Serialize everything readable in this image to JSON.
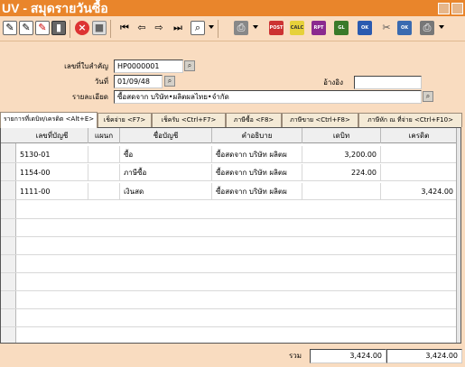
{
  "window": {
    "title": "UV - สมุดรายวันซื้อ"
  },
  "toolbar": {
    "icons": [
      "new-doc-icon",
      "edit-doc-icon",
      "copy-doc-icon",
      "trash-icon",
      "cancel-icon",
      "save-icon",
      "first-record-icon",
      "prev-record-icon",
      "next-record-icon",
      "last-record-icon",
      "search-icon",
      "print-icon",
      "post-icon",
      "calc-icon",
      "gl-icon",
      "ok-user-icon",
      "attach-icon",
      "ok-printer-icon",
      "print-options-icon"
    ]
  },
  "form": {
    "doc_no_label": "เลขที่ใบสำคัญ",
    "doc_no_value": "HP0000001",
    "date_label": "วันที่",
    "date_value": "01/09/48",
    "ref_label": "อ้างอิง",
    "ref_value": "",
    "desc_label": "รายละเอียด",
    "desc_value": "ซื้อสดจาก       บริษัท•ผลิตผลไทย•จำกัด"
  },
  "tabs": [
    {
      "label": "รายการที่เดบิท/เครดิต <Alt+E>"
    },
    {
      "label": "เช็คจ่าย <F7>"
    },
    {
      "label": "เช็ครับ <Ctrl+F7>"
    },
    {
      "label": "ภาษีซื้อ <F8>"
    },
    {
      "label": "ภาษีขาย <Ctrl+F8>"
    },
    {
      "label": "ภาษีหัก ณ ที่จ่าย <Ctrl+F10>"
    }
  ],
  "grid": {
    "headers": [
      "เลขที่บัญชี",
      "แผนก",
      "ชื่อบัญชี",
      "คำอธิบาย",
      "เดบิท",
      "เครดิต"
    ],
    "rows": [
      {
        "account": "5130-01",
        "dept": "",
        "name": "ซื้อ",
        "desc": "ซื้อสดจาก    บริษัท ผลิตผ",
        "debit": "3,200.00",
        "credit": ""
      },
      {
        "account": "1154-00",
        "dept": "",
        "name": "ภาษีซื้อ",
        "desc": "ซื้อสดจาก    บริษัท ผลิตผ",
        "debit": "224.00",
        "credit": ""
      },
      {
        "account": "1111-00",
        "dept": "",
        "name": "เงินสด",
        "desc": "ซื้อสดจาก    บริษัท ผลิตผ",
        "debit": "",
        "credit": "3,424.00"
      }
    ]
  },
  "footer": {
    "total_label": "รวม",
    "total_debit": "3,424.00",
    "total_credit": "3,424.00"
  }
}
